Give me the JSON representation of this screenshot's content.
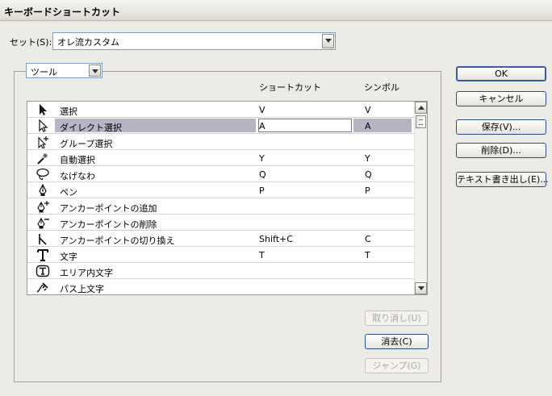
{
  "window": {
    "title": "キーボードショートカット"
  },
  "set": {
    "label": "セット(S):",
    "value": "オレ流カスタム"
  },
  "category": {
    "value": "ツール"
  },
  "columns": {
    "shortcut": "ショートカット",
    "symbol": "シンボル"
  },
  "tools": [
    {
      "icon": "selection-arrow-icon",
      "name": "選択",
      "shortcut": "V",
      "symbol": "V"
    },
    {
      "icon": "direct-selection-arrow-icon",
      "name": "ダイレクト選択",
      "shortcut": "A",
      "symbol": "A",
      "selected": true
    },
    {
      "icon": "group-selection-icon",
      "name": "グループ選択",
      "shortcut": "",
      "symbol": ""
    },
    {
      "icon": "magic-wand-icon",
      "name": "自動選択",
      "shortcut": "Y",
      "symbol": "Y"
    },
    {
      "icon": "lasso-icon",
      "name": "なげなわ",
      "shortcut": "Q",
      "symbol": "Q"
    },
    {
      "icon": "pen-icon",
      "name": "ペン",
      "shortcut": "P",
      "symbol": "P"
    },
    {
      "icon": "add-anchor-point-icon",
      "name": "アンカーポイントの追加",
      "shortcut": "",
      "symbol": ""
    },
    {
      "icon": "delete-anchor-point-icon",
      "name": "アンカーポイントの削除",
      "shortcut": "",
      "symbol": ""
    },
    {
      "icon": "convert-anchor-point-icon",
      "name": "アンカーポイントの切り換え",
      "shortcut": "Shift+C",
      "symbol": "C"
    },
    {
      "icon": "type-icon",
      "name": "文字",
      "shortcut": "T",
      "symbol": "T"
    },
    {
      "icon": "area-type-icon",
      "name": "エリア内文字",
      "shortcut": "",
      "symbol": ""
    },
    {
      "icon": "type-on-path-icon",
      "name": "パス上文字",
      "shortcut": "",
      "symbol": ""
    }
  ],
  "buttons": {
    "ok": "OK",
    "cancel": "キャンセル",
    "save": "保存(V)...",
    "delete": "削除(D)...",
    "export_text": "テキスト書き出し(E)...",
    "undo": "取り消し(U)",
    "clear": "消去(C)",
    "jump": "ジャンプ(G)"
  }
}
